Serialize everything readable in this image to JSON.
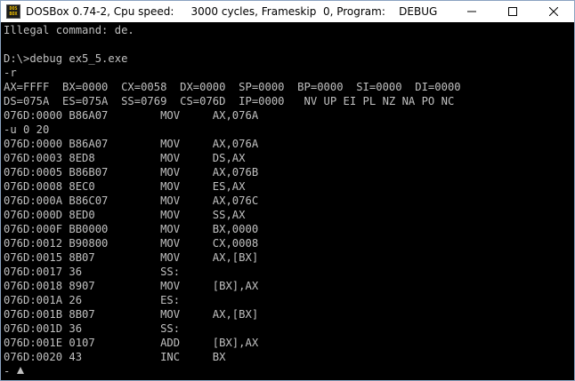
{
  "window": {
    "title": "DOSBox 0.74-2, Cpu speed:     3000 cycles, Frameskip  0, Program:    DEBUG",
    "icon": "dosbox-icon",
    "icon_text_top": "DOS",
    "icon_text_bottom": "BOX",
    "controls": {
      "minimize": "minimize-icon",
      "maximize": "maximize-icon",
      "close": "close-icon"
    }
  },
  "console": {
    "lines": [
      "Illegal command: de.",
      "",
      "D:\\>debug ex5_5.exe",
      "-r",
      "AX=FFFF  BX=0000  CX=0058  DX=0000  SP=0000  BP=0000  SI=0000  DI=0000",
      "DS=075A  ES=075A  SS=0769  CS=076D  IP=0000   NV UP EI PL NZ NA PO NC",
      "076D:0000 B86A07        MOV     AX,076A",
      "-u 0 20",
      "076D:0000 B86A07        MOV     AX,076A",
      "076D:0003 8ED8          MOV     DS,AX",
      "076D:0005 B86B07        MOV     AX,076B",
      "076D:0008 8EC0          MOV     ES,AX",
      "076D:000A B86C07        MOV     AX,076C",
      "076D:000D 8ED0          MOV     SS,AX",
      "076D:000F BB0000        MOV     BX,0000",
      "076D:0012 B90800        MOV     CX,0008",
      "076D:0015 8B07          MOV     AX,[BX]",
      "076D:0017 36            SS:",
      "076D:0018 8907          MOV     [BX],AX",
      "076D:001A 26            ES:",
      "076D:001B 8B07          MOV     AX,[BX]",
      "076D:001D 36            SS:",
      "076D:001E 0107          ADD     [BX],AX",
      "076D:0020 43            INC     BX",
      "-"
    ]
  },
  "colors": {
    "console_bg": "#000000",
    "console_fg": "#c0c0c0",
    "titlebar_bg": "#ffffff"
  }
}
